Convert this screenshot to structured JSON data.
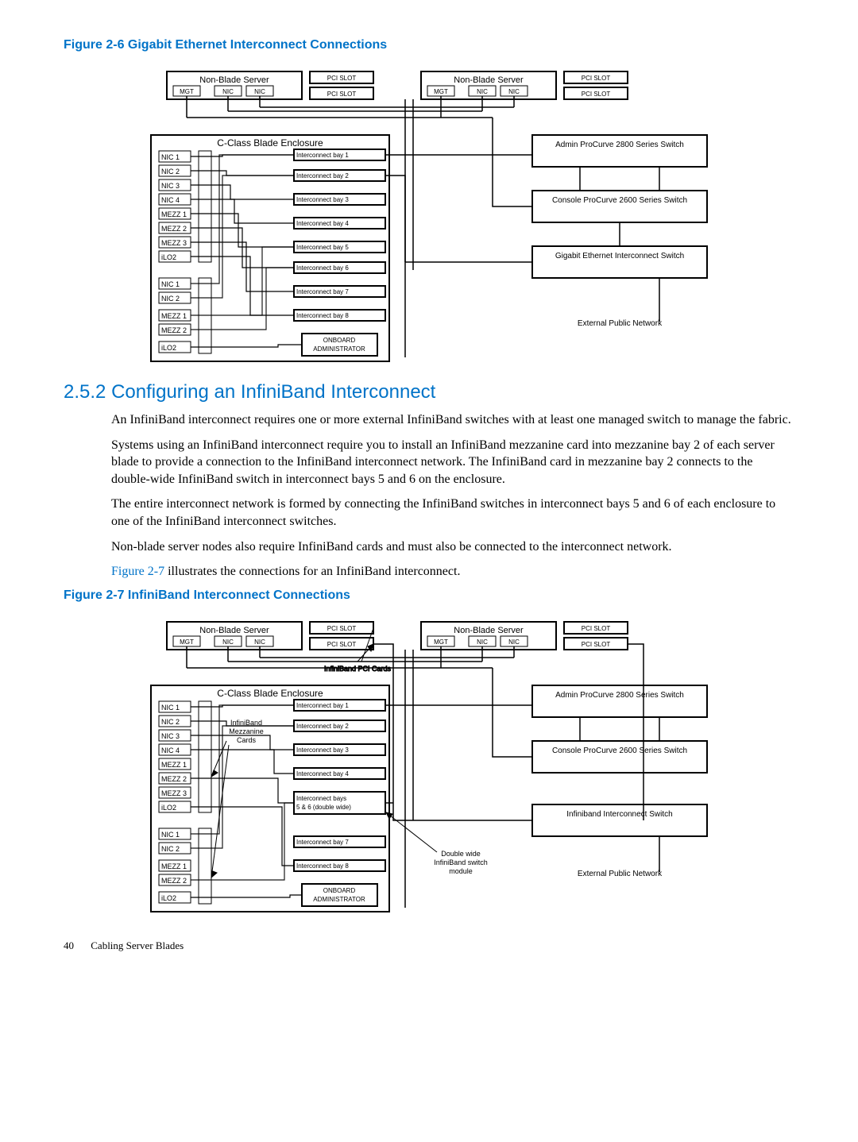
{
  "figure1": {
    "title": "Figure 2-6 Gigabit Ethernet Interconnect Connections",
    "nonBlade": "Non-Blade Server",
    "mgt": "MGT",
    "nic": "NIC",
    "pci": "PCI SLOT",
    "enclosure": "C-Class Blade Enclosure",
    "nic1": "NIC 1",
    "nic2": "NIC 2",
    "nic3": "NIC 3",
    "nic4": "NIC 4",
    "mezz1": "MEZZ 1",
    "mezz2": "MEZZ 2",
    "mezz3": "MEZZ 3",
    "ilo2": "iLO2",
    "ib1": "Interconnect bay 1",
    "ib2": "Interconnect bay 2",
    "ib3": "Interconnect bay 3",
    "ib4": "Interconnect bay 4",
    "ib5": "Interconnect bay 5",
    "ib6": "Interconnect bay 6",
    "ib7": "Interconnect bay 7",
    "ib8": "Interconnect bay 8",
    "oa1": "ONBOARD",
    "oa2": "ADMINISTRATOR",
    "admin": "Admin ProCurve 2800 Series Switch",
    "console": "Console ProCurve 2600 Series Switch",
    "gige": "Gigabit Ethernet Interconnect Switch",
    "ext": "External Public Network"
  },
  "section": {
    "number": "2.5.2",
    "title": "Configuring an InfiniBand Interconnect",
    "p1": "An InfiniBand interconnect requires one or more external InfiniBand switches with at least one managed switch to manage the fabric.",
    "p2": "Systems using an InfiniBand interconnect require you to install an InfiniBand mezzanine card into mezzanine bay 2 of each server blade to provide a connection to the InfiniBand interconnect network. The InfiniBand card in mezzanine bay 2 connects to the double-wide InfiniBand switch in interconnect bays 5 and 6 on the enclosure.",
    "p3": "The entire interconnect network is formed by connecting the InfiniBand switches in interconnect bays 5 and 6 of each enclosure to one of the InfiniBand interconnect switches.",
    "p4": "Non-blade server nodes also require InfiniBand cards and must also be connected to the interconnect network.",
    "p5_link": "Figure 2-7",
    "p5_rest": " illustrates the connections for an InfiniBand interconnect."
  },
  "figure2": {
    "title": "Figure 2-7 InfiniBand Interconnect Connections",
    "nonBlade": "Non-Blade Server",
    "mgt": "MGT",
    "nic": "NIC",
    "pci": "PCI SLOT",
    "ibpci": "InfiniBand PCI Cards",
    "enclosure": "C-Class Blade Enclosure",
    "nic1": "NIC 1",
    "nic2": "NIC 2",
    "nic3": "NIC 3",
    "nic4": "NIC 4",
    "mezz1": "MEZZ 1",
    "mezz2": "MEZZ 2",
    "mezz3": "MEZZ 3",
    "ilo2": "iLO2",
    "ibmc1": "InfiniBand",
    "ibmc2": "Mezzanine",
    "ibmc3": "Cards",
    "ib1": "Interconnect bay 1",
    "ib2": "Interconnect bay 2",
    "ib3": "Interconnect bay 3",
    "ib4": "Interconnect bay 4",
    "ib56a": "Interconnect bays",
    "ib56b": "5 & 6 (double wide)",
    "ib7": "Interconnect bay 7",
    "ib8": "Interconnect bay 8",
    "oa1": "ONBOARD",
    "oa2": "ADMINISTRATOR",
    "admin": "Admin ProCurve 2800 Series Switch",
    "console": "Console ProCurve 2600 Series Switch",
    "ibsw": "Infiniband Interconnect Switch",
    "ext": "External Public Network",
    "dw1": "Double wide",
    "dw2": "InfiniBand switch",
    "dw3": "module"
  },
  "footer": {
    "page": "40",
    "chapter": "Cabling Server Blades"
  }
}
